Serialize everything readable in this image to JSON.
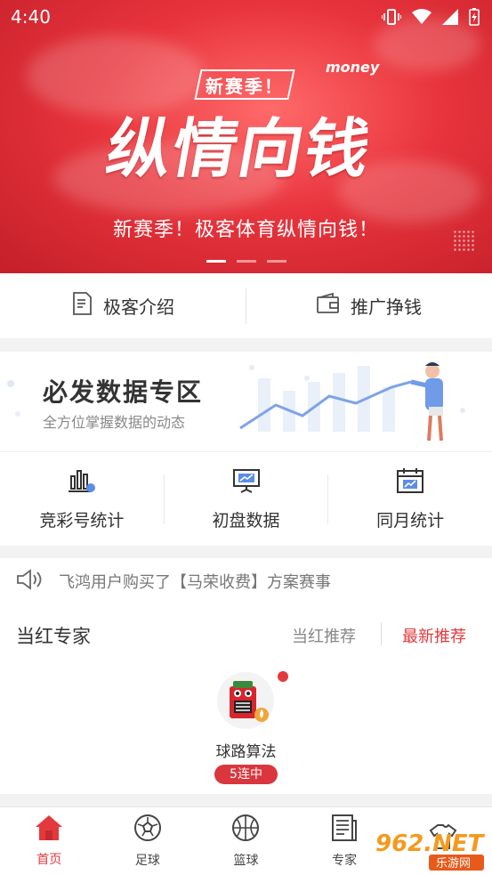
{
  "status_bar": {
    "time": "4:40"
  },
  "banner": {
    "tag": "新赛季！",
    "money_text": "money",
    "title": "纵情向钱",
    "subtitle": "新赛季！极客体育纵情向钱！",
    "indicator_count": 3,
    "active_indicator": 0
  },
  "intro": {
    "items": [
      {
        "label": "极客介绍",
        "icon": "document-icon"
      },
      {
        "label": "推广挣钱",
        "icon": "wallet-icon"
      }
    ]
  },
  "data_zone": {
    "title": "必发数据专区",
    "subtitle": "全方位掌握数据的动态"
  },
  "stats": {
    "items": [
      {
        "label": "竞彩号统计",
        "icon": "bar-chart-icon"
      },
      {
        "label": "初盘数据",
        "icon": "presentation-chart-icon"
      },
      {
        "label": "同月统计",
        "icon": "calendar-chart-icon"
      }
    ]
  },
  "notice": {
    "text": "飞鸿用户购买了【马荣收费】方案赛事",
    "icon": "speaker-icon"
  },
  "experts": {
    "title": "当红专家",
    "tab_hot": "当红推荐",
    "tab_latest": "最新推荐",
    "list": [
      {
        "name": "球路算法",
        "badge": "5连中"
      }
    ]
  },
  "bottom_nav": {
    "items": [
      {
        "label": "首页",
        "icon": "home-icon",
        "active": true
      },
      {
        "label": "足球",
        "icon": "soccer-ball-icon",
        "active": false
      },
      {
        "label": "篮球",
        "icon": "basketball-icon",
        "active": false
      },
      {
        "label": "专家",
        "icon": "article-icon",
        "active": false
      },
      {
        "label": "",
        "icon": "shirt-icon",
        "active": false
      }
    ]
  },
  "watermark": {
    "text": "962.NET",
    "sub": "乐游网"
  },
  "colors": {
    "accent": "#e4393c",
    "banner": "#e8343c"
  }
}
